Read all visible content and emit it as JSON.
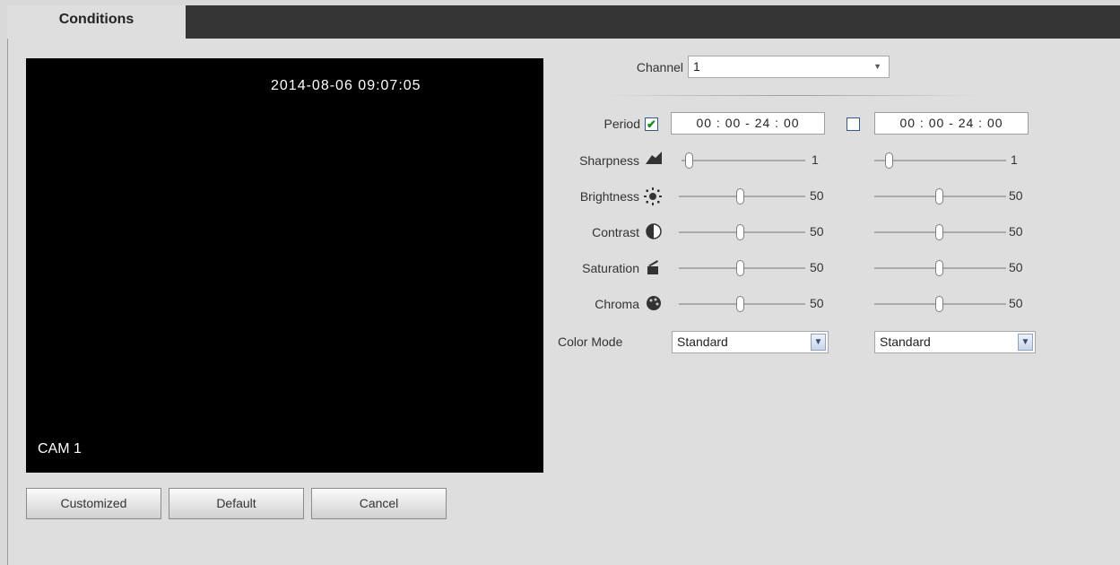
{
  "tab": {
    "label": "Conditions"
  },
  "preview": {
    "timestamp": "2014-08-06 09:07:05",
    "camera_label": "CAM 1"
  },
  "buttons": {
    "customized": "Customized",
    "default": "Default",
    "cancel": "Cancel"
  },
  "channel": {
    "label": "Channel",
    "value": "1"
  },
  "period": {
    "label": "Period",
    "checked1": true,
    "checked2": false,
    "time1": "00 : 00 - 24 : 00",
    "time2": "00 : 00 - 24 : 00",
    "check_glyph": "✔"
  },
  "sliders": [
    {
      "label": "Sharpness",
      "icon": "sharpness-icon",
      "value1": "1",
      "value2": "1"
    },
    {
      "label": "Brightness",
      "icon": "brightness-icon",
      "value1": "50",
      "value2": "50"
    },
    {
      "label": "Contrast",
      "icon": "contrast-icon",
      "value1": "50",
      "value2": "50"
    },
    {
      "label": "Saturation",
      "icon": "saturation-icon",
      "value1": "50",
      "value2": "50"
    },
    {
      "label": "Chroma",
      "icon": "chroma-icon",
      "value1": "50",
      "value2": "50"
    }
  ],
  "color_mode": {
    "label": "Color Mode",
    "value1": "Standard",
    "value2": "Standard"
  },
  "arrow_glyph": "▼",
  "colors": {
    "tabbar": "#353535",
    "panel": "#dedede",
    "preview": "#000000"
  }
}
